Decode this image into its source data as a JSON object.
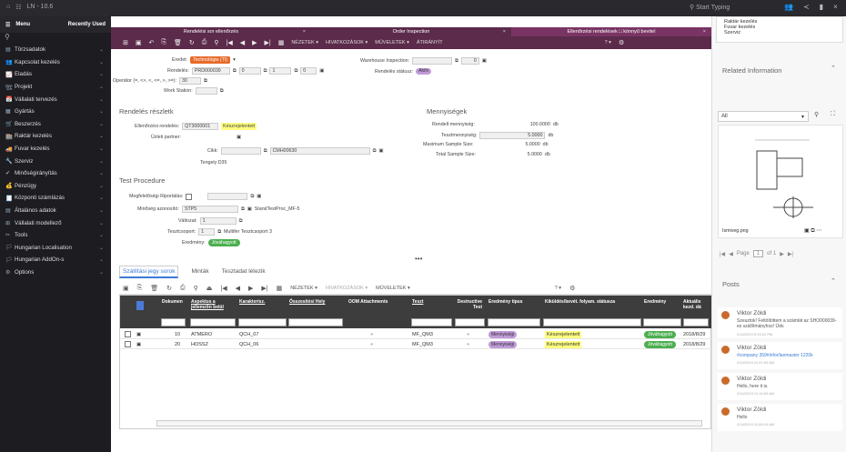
{
  "topbar": {
    "brand": "LN - 10.6",
    "search_placeholder": "Start Typing"
  },
  "dropdown": {
    "items": [
      "Raktár kezelés",
      "Fuvar kezelés",
      "Szerviz"
    ]
  },
  "sidebar": {
    "menu_label": "Menu",
    "recent_label": "Recently Used",
    "items": [
      {
        "label": "Törzsadatok"
      },
      {
        "label": "Kapcsolat kezelés"
      },
      {
        "label": "Eladás"
      },
      {
        "label": "Projekt"
      },
      {
        "label": "Vállalati tervezés"
      },
      {
        "label": "Gyártás"
      },
      {
        "label": "Beszerzés"
      },
      {
        "label": "Raktár kezelés"
      },
      {
        "label": "Fuvar kezelés"
      },
      {
        "label": "Szerviz"
      },
      {
        "label": "Minőségirányítás"
      },
      {
        "label": "Pénzügy"
      },
      {
        "label": "Központi számlázás"
      },
      {
        "label": "Általános adatok"
      },
      {
        "label": "Vállalati modellező"
      },
      {
        "label": "Tools"
      },
      {
        "label": "Hungarian Localisation"
      },
      {
        "label": "Hungarian AddOn-s"
      },
      {
        "label": "Options"
      }
    ]
  },
  "tabs": [
    {
      "label": "Rendelési sor ellenőrzés"
    },
    {
      "label": "Order Inspection"
    },
    {
      "label": "Ellenőrzési rendelések □ könnyű bevitel"
    }
  ],
  "toolbar": {
    "views": "NÉZETEK ▾",
    "refs": "HIVATKOZÁSOK ▾",
    "actions": "MŰVELETEK ▾",
    "route": "ÁTIRÁNYÍT",
    "help": "? ▾"
  },
  "form": {
    "eredet_label": "Eredet:",
    "eredet_value": "Technológia (TI)",
    "rendeles_label": "Rendelés:",
    "rendeles_value": "PRD000039",
    "rendeles_2": "0",
    "rendeles_3": "1",
    "rendeles_4": "0",
    "operator_label": "Operátor (=, <>, <, <=, >, >=):",
    "operator_value": "30",
    "workstation_label": "Work Station:",
    "warehouse_label": "Warehouse Inspection:",
    "warehouse_value": "0",
    "status_label": "Rendelés státusz:",
    "status_value": "Aktív",
    "section1": "Rendelés részletk",
    "section_qty": "Mennyiségek",
    "ell_label": "Ellenőrzési rendelés:",
    "ell_value": "QT3000001",
    "ell_status": "Készrejelentett",
    "partner_label": "Üzleti partner:",
    "cikk_label": "Cikk:",
    "cikk_value": "CMH00630",
    "cikk_desc": "Tengely D35",
    "q1_label": "Rendelt mennyiség:",
    "q1_value": "100.0000",
    "q1_unit": "db",
    "q2_label": "Tesztmennyiség:",
    "q2_value": "5.0000",
    "q2_unit": "db",
    "q3_label": "Maximum Sample Size:",
    "q3_value": "5.0000",
    "q3_unit": "db",
    "q4_label": "Total Sample Size:",
    "q4_value": "5.0000",
    "q4_unit": "db",
    "section2": "Test Procedure",
    "report_label": "Megfelelőségi Riportálás:",
    "min_label": "Minőség azonosító:",
    "min_value": "STP5",
    "min_desc": "StandTestProc_MF-5",
    "valt_label": "Változat:",
    "valt_value": "1",
    "teszt_label": "Tesztcsoport:",
    "teszt_value": "1",
    "teszt_desc": "Multifer Tesztcsoport 3",
    "ered_label": "Eredmény:",
    "ered_value": "Jóváhagyott"
  },
  "subtabs": [
    {
      "label": "Szállítási jegy sorok"
    },
    {
      "label": "Minták"
    },
    {
      "label": "Tesztadat létezik"
    }
  ],
  "grid": {
    "headers": [
      "Dokumen",
      "Aspektus a jellemzőn belül",
      "Karakterisz.",
      "Összesítési Hely",
      "OOM Attachments",
      "Teszt",
      "Destructive Test",
      "Eredmény típus",
      "Kiküldés/bevét. folyam. státusza",
      "Eredmény",
      "Aktuális kezd. dá"
    ],
    "rows": [
      {
        "doc": "10",
        "aspect": "ATMERO",
        "char": "QCH_07",
        "test": "MF_QM3",
        "type": "Mennyiségi",
        "status": "Készrejelentett",
        "result": "Jóváhagyott",
        "date": "2018/8/29"
      },
      {
        "doc": "20",
        "aspect": "HOSSZ",
        "char": "QCH_06",
        "test": "MF_QM3",
        "type": "Mennyiségi",
        "status": "Készrejelentett",
        "result": "Jóváhagyott",
        "date": "2018/8/29"
      }
    ]
  },
  "right": {
    "related_title": "Related Information",
    "filter": "All",
    "file": "Ismiveg.png",
    "page_label": "Page",
    "page": "1",
    "of": "of 1",
    "posts_title": "Posts",
    "posts": [
      {
        "name": "Viktor Zöldi",
        "text": "Szeuztok! Feltöltöttem a számlát az SHO000039-es szállítmányhoz! Üdv.",
        "time": "2/14/2019 5:33:22 PM"
      },
      {
        "name": "Viktor Zöldi",
        "text": "#company 359#infor/lanmaster 1220k",
        "time": "2/14/2019 11:21:54 AM"
      },
      {
        "name": "Viktor Zöldi",
        "text": "Hello, here it is.",
        "time": "2/14/2019 11:18:53 AM"
      },
      {
        "name": "Viktor Zöldi",
        "text": "Hello",
        "time": "2/14/2019 11:08:14 AM"
      }
    ]
  }
}
